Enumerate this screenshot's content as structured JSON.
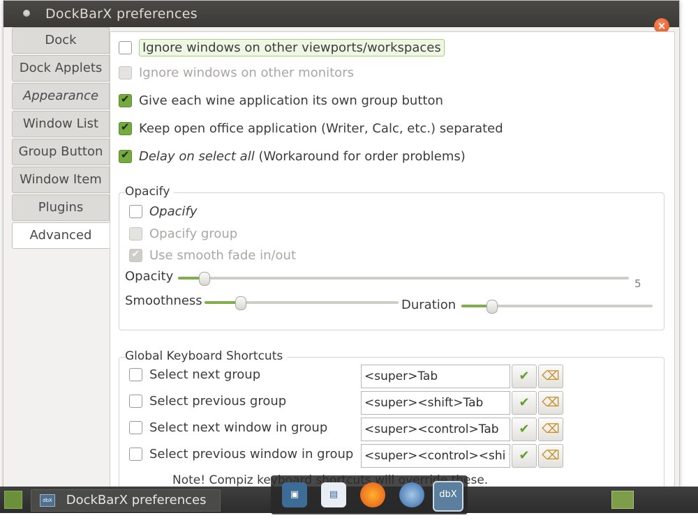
{
  "window": {
    "title": "DockBarX preferences",
    "close_icon": "×"
  },
  "tabs": [
    {
      "label": "Dock",
      "active": false
    },
    {
      "label": "Dock Applets",
      "active": false
    },
    {
      "label": "Appearance",
      "active": false
    },
    {
      "label": "Window List",
      "active": false
    },
    {
      "label": "Group Button",
      "active": false
    },
    {
      "label": "Window Item",
      "active": false
    },
    {
      "label": "Plugins",
      "active": false
    },
    {
      "label": "Advanced",
      "active": true
    }
  ],
  "options": {
    "ignore_viewports": {
      "label": "Ignore windows on other viewports/workspaces",
      "checked": false
    },
    "ignore_monitors": {
      "label": "Ignore windows on other monitors",
      "checked": false,
      "disabled": true
    },
    "wine_groups": {
      "label": "Give each wine application its own group button",
      "checked": true
    },
    "openoffice_separate": {
      "label": "Keep open office application (Writer, Calc, etc.) separated",
      "checked": true
    },
    "delay_select_all": {
      "label_italic": "Delay on select all",
      "label_rest": " (Workaround for order problems)",
      "checked": true
    }
  },
  "opacify": {
    "frame_label": "Opacify",
    "opacify": {
      "label": "Opacify",
      "checked": false
    },
    "opacify_group": {
      "label": "Opacify group",
      "checked": false,
      "disabled": true
    },
    "smooth_fade": {
      "label": "Use smooth fade in/out",
      "checked": true,
      "disabled": true
    },
    "opacity_label": "Opacity",
    "opacity_value": "5",
    "smoothness_label": "Smoothness",
    "duration_label": "Duration"
  },
  "shortcuts": {
    "frame_label": "Global Keyboard Shortcuts",
    "items": [
      {
        "label": "Select next group",
        "value": "<super>Tab"
      },
      {
        "label": "Select previous group",
        "value": "<super><shift>Tab"
      },
      {
        "label": "Select next window in group",
        "value": "<super><control>Tab"
      },
      {
        "label": "Select previous window in group",
        "value": "<super><control><shi"
      }
    ],
    "note": "Note! Compiz keyboard shortcuts will override these."
  },
  "taskbar": {
    "task_label": "DockBarX preferences",
    "task_icon_text": "dbX"
  },
  "dock": {
    "icons": [
      "screenshot-icon",
      "document-viewer-icon",
      "firefox-icon",
      "thunderbird-icon",
      "dockbarx-icon"
    ],
    "dbx_text": "dbX"
  },
  "colors": {
    "accent": "#74aa3f",
    "close": "#e0541f",
    "titlebar": "#3b3a37"
  }
}
